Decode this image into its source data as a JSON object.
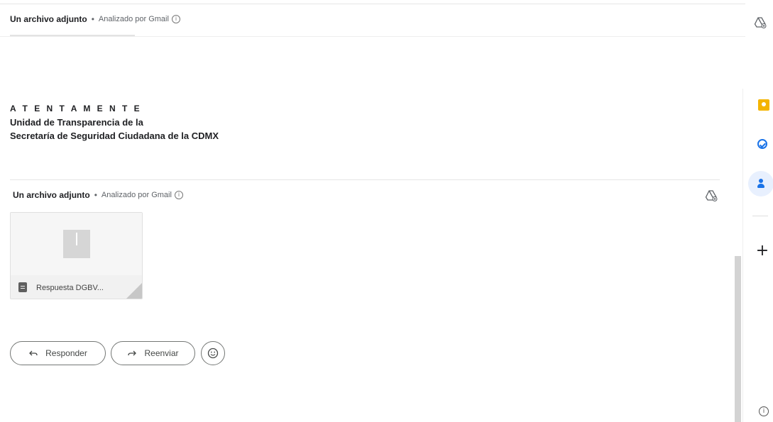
{
  "top_attachment": {
    "title": "Un archivo adjunto",
    "separator": "•",
    "subtitle": "Analizado por Gmail",
    "info_icon": "i"
  },
  "signature": {
    "line1": "A T E N T A M E N T E",
    "line2": "Unidad de Transparencia de la",
    "line3": "Secretaría de Seguridad Ciudadana de la CDMX"
  },
  "attachment_section": {
    "title": "Un archivo adjunto",
    "separator": "•",
    "subtitle": "Analizado por Gmail",
    "info_icon": "i",
    "file_name": "Respuesta DGBV..."
  },
  "actions": {
    "reply_label": "Responder",
    "forward_label": "Reenviar",
    "reply_icon": "reply-icon",
    "forward_icon": "forward-icon",
    "emoji_icon": "emoji-icon"
  },
  "sidebar": {
    "items": [
      {
        "name": "keep-icon",
        "color": "#f4b400"
      },
      {
        "name": "tasks-icon",
        "color": "#1a73e8"
      },
      {
        "name": "contacts-icon",
        "color": "#1a73e8"
      },
      {
        "name": "plus-icon",
        "label": "+"
      }
    ],
    "info_label": "i"
  },
  "colors": {
    "accent_blue": "#1a73e8",
    "keep_yellow": "#f4b400",
    "button_border": "#747775",
    "text_secondary": "#5f6368"
  }
}
